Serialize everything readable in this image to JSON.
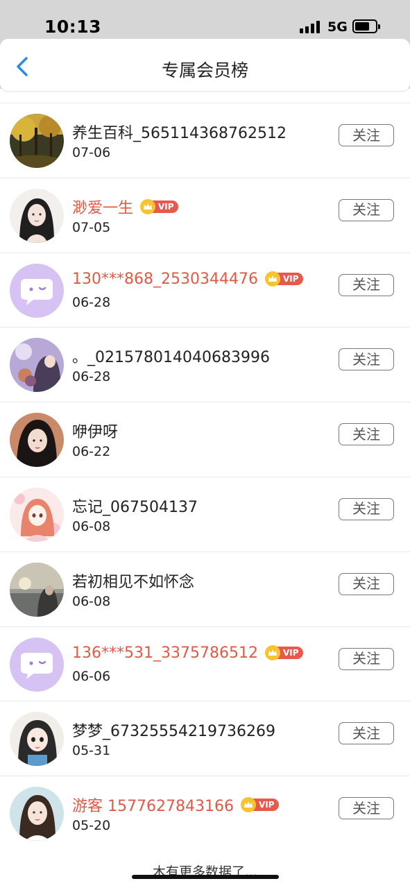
{
  "status_bar": {
    "time": "10:13",
    "network": "5G"
  },
  "header": {
    "title": "专属会员榜"
  },
  "list": {
    "follow_label": "关注",
    "vip_label": "VIP",
    "items": [
      {
        "name": "养生百科_565114368762512",
        "date": "07-06",
        "vip": false,
        "avatar": "forest"
      },
      {
        "name": "渺爱一生",
        "date": "07-05",
        "vip": true,
        "avatar": "girl-sketch"
      },
      {
        "name": "130***868_2530344476",
        "date": "06-28",
        "vip": true,
        "avatar": "chat-bubble"
      },
      {
        "name": "。_021578014040683996",
        "date": "06-28",
        "vip": false,
        "avatar": "purple-photo"
      },
      {
        "name": "咿伊呀",
        "date": "06-22",
        "vip": false,
        "avatar": "girl-dark"
      },
      {
        "name": "忘记_067504137",
        "date": "06-08",
        "vip": false,
        "avatar": "anime-girl"
      },
      {
        "name": "若初相见不如怀念",
        "date": "06-08",
        "vip": false,
        "avatar": "sunset-girl"
      },
      {
        "name": "136***531_3375786512",
        "date": "06-06",
        "vip": true,
        "avatar": "chat-bubble"
      },
      {
        "name": "梦梦_67325554219736269",
        "date": "05-31",
        "vip": false,
        "avatar": "cartoon-girl"
      },
      {
        "name": "游客 1577627843166",
        "date": "05-20",
        "vip": true,
        "avatar": "girl-photo"
      }
    ]
  },
  "footer": {
    "text": "木有更多数据了..."
  }
}
